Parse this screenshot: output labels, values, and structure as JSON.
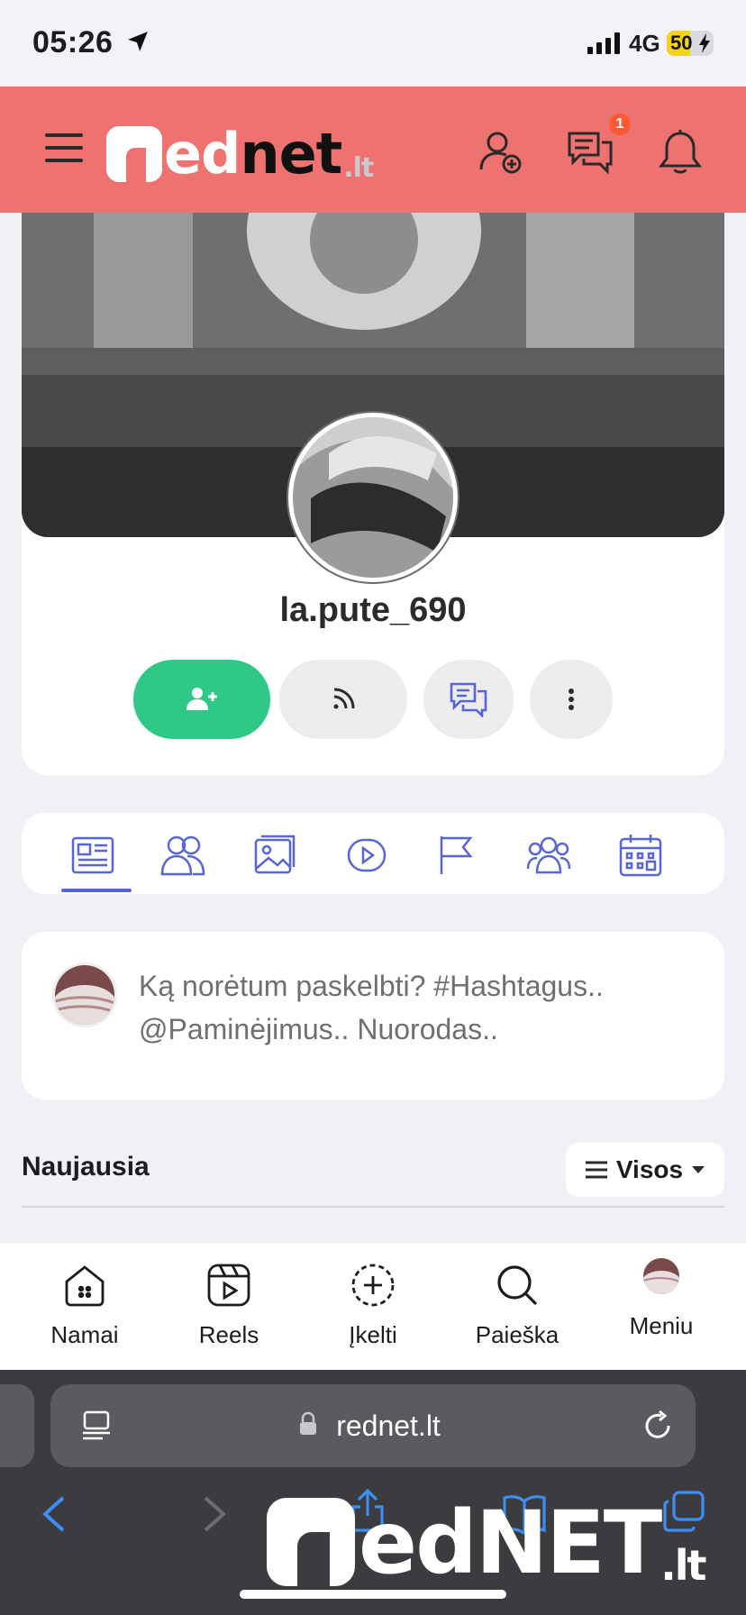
{
  "status_bar": {
    "time": "05:26",
    "network": "4G",
    "battery": "50",
    "battery_fraction": 0.5
  },
  "header": {
    "logo": {
      "ed": "ed",
      "net": "net",
      "tld": ".lt"
    },
    "messages_badge": "1"
  },
  "profile": {
    "username": "la.pute_690"
  },
  "composer": {
    "placeholder": "Ką norėtum paskelbti? #Hashtagus.. @Paminėjimus.. Nuorodas.."
  },
  "feed": {
    "title": "Naujausia",
    "filter_label": "Visos"
  },
  "bottom_nav": {
    "items": [
      {
        "label": "Namai",
        "icon": "home-icon"
      },
      {
        "label": "Reels",
        "icon": "reels-icon"
      },
      {
        "label": "Įkelti",
        "icon": "upload-icon"
      },
      {
        "label": "Paieška",
        "icon": "search-icon"
      },
      {
        "label": "Meniu",
        "icon": "avatar"
      }
    ]
  },
  "browser": {
    "url": "rednet.lt"
  },
  "watermark": {
    "ed": "edNET",
    "tld": ".lt"
  },
  "colors": {
    "header": "#ee7270",
    "accent": "#5865d8",
    "follow_green": "#2ec986",
    "badge": "#ff5a36"
  }
}
